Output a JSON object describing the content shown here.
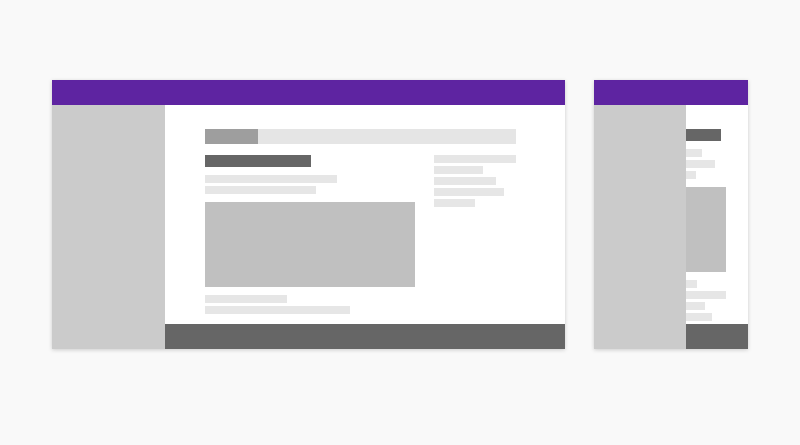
{
  "colors": {
    "page_background": "#f9f9f9",
    "header": "#5e24a1",
    "sidebar": "#cbcbcb",
    "footer": "#666666",
    "content": "#ffffff",
    "heading_block": "#666666",
    "tab_active": "#9e9e9e",
    "tab_strip": "#e5e5e5",
    "text_line": "#e6e6e6",
    "media_block": "#c0c0c0"
  },
  "wireframes": [
    {
      "name": "desktop-layout"
    },
    {
      "name": "narrow-layout"
    }
  ]
}
